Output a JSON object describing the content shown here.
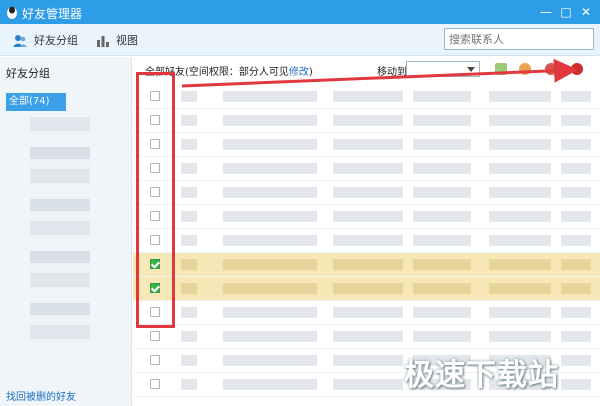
{
  "window": {
    "title": "好友管理器",
    "minimize": "—",
    "maximize": "□",
    "close": "✕"
  },
  "toolbar": {
    "group_label": "好友分组",
    "group_icon": "people-icon",
    "view_label": "视图",
    "view_icon": "bar-chart-icon",
    "search_placeholder": "搜索联系人"
  },
  "sidebar": {
    "header": "好友分组",
    "all_item": "全部(",
    "all_count": "74)",
    "restore_link": "找回被删的好友"
  },
  "main": {
    "header_prefix": "全部好友(空间权限：部分人可见",
    "header_link": "修改",
    "header_suffix": ")",
    "move_to_label": "移动到",
    "move_to_value": ""
  },
  "rows": [
    {
      "checked": false
    },
    {
      "checked": false
    },
    {
      "checked": false
    },
    {
      "checked": false
    },
    {
      "checked": false
    },
    {
      "checked": false
    },
    {
      "checked": false
    },
    {
      "checked": true
    },
    {
      "checked": true
    },
    {
      "checked": false
    },
    {
      "checked": false
    },
    {
      "checked": false
    },
    {
      "checked": false
    }
  ],
  "watermark": "极速下载站",
  "colors": {
    "titlebar": "#2c9de6",
    "selected_row": "#f5e7b6",
    "annotation": "#e0383e",
    "check": "#3bb54a"
  }
}
